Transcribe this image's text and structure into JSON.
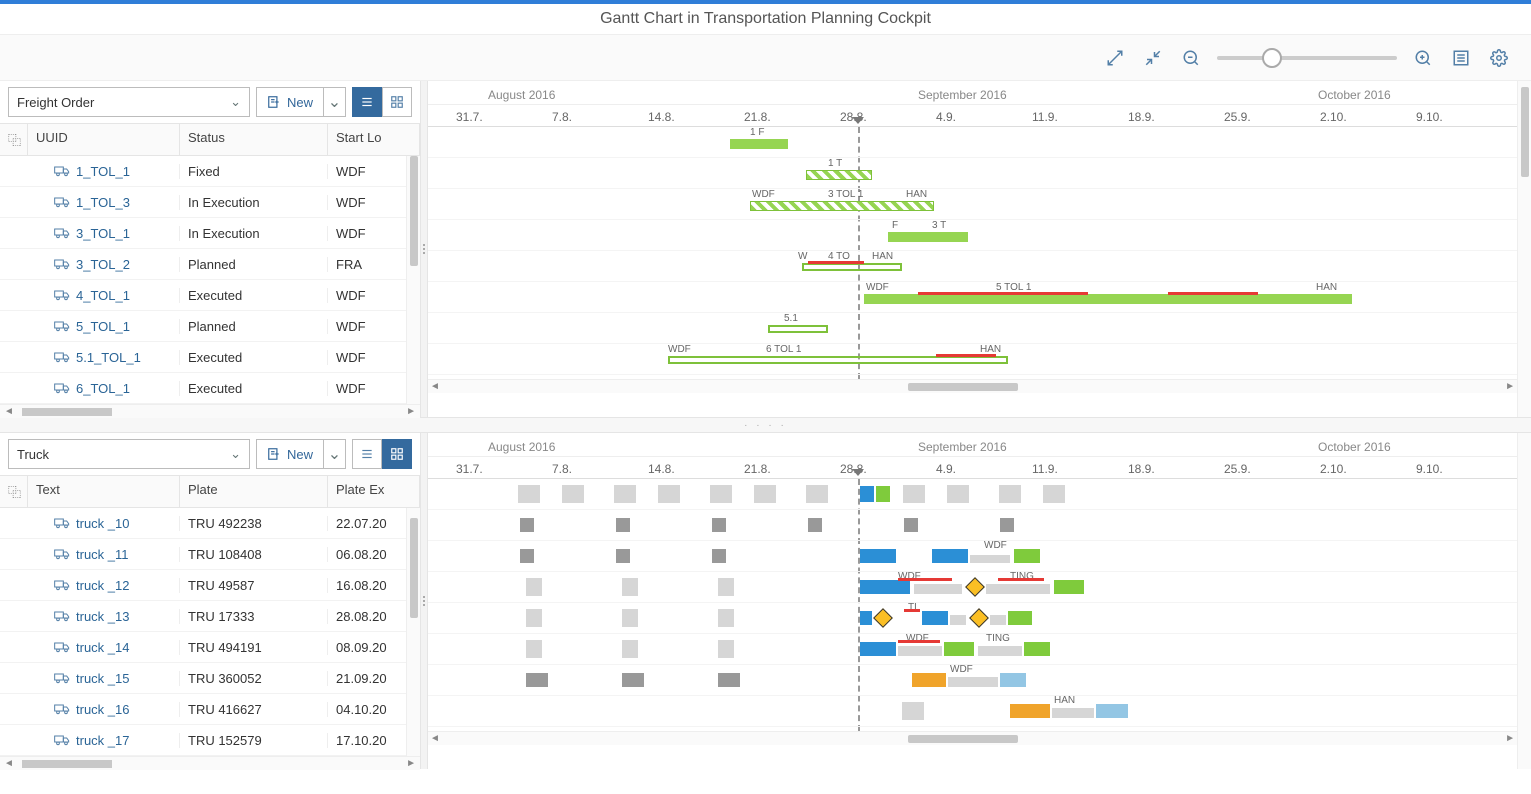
{
  "page": {
    "title": "Gantt Chart in Transportation Planning Cockpit"
  },
  "timeline": {
    "months": [
      "August 2016",
      "September 2016",
      "October 2016"
    ],
    "ticks": [
      "31.7.",
      "7.8.",
      "14.8.",
      "21.8.",
      "28.8.",
      "4.9.",
      "11.9.",
      "18.9.",
      "25.9.",
      "2.10.",
      "9.10."
    ]
  },
  "top": {
    "dropdown_value": "Freight Order",
    "new_button_label": "New",
    "columns": {
      "c1": "UUID",
      "c2": "Status",
      "c3": "Start Lo"
    },
    "rows": [
      {
        "uuid": "1_TOL_1",
        "status": "Fixed",
        "start": "WDF"
      },
      {
        "uuid": "1_TOL_3",
        "status": "In Execution",
        "start": "WDF"
      },
      {
        "uuid": "3_TOL_1",
        "status": "In Execution",
        "start": "WDF"
      },
      {
        "uuid": "3_TOL_2",
        "status": "Planned",
        "start": "FRA"
      },
      {
        "uuid": "4_TOL_1",
        "status": "Executed",
        "start": "WDF"
      },
      {
        "uuid": "5_TOL_1",
        "status": "Planned",
        "start": "WDF"
      },
      {
        "uuid": "5.1_TOL_1",
        "status": "Executed",
        "start": "WDF"
      },
      {
        "uuid": "6_TOL_1",
        "status": "Executed",
        "start": "WDF"
      }
    ],
    "bar_labels": {
      "r0": "1 F",
      "r1": "1 T",
      "r2a": "WDF",
      "r2b": "3 TOL 1",
      "r2c": "HAN",
      "r3a": "F",
      "r3b": "3 T",
      "r4a": "W",
      "r4b": "4 TO",
      "r4c": "HAN",
      "r5a": "WDF",
      "r5b": "5 TOL 1",
      "r5c": "HAN",
      "r6": "5.1",
      "r7a": "WDF",
      "r7b": "6 TOL 1",
      "r7c": "HAN"
    }
  },
  "bottom": {
    "dropdown_value": "Truck",
    "new_button_label": "New",
    "columns": {
      "c1": "Text",
      "c2": "Plate",
      "c3": "Plate Ex"
    },
    "rows": [
      {
        "text": "truck _10",
        "plate": "TRU 492238",
        "exp": "22.07.20"
      },
      {
        "text": "truck _11",
        "plate": "TRU 108408",
        "exp": "06.08.20"
      },
      {
        "text": "truck _12",
        "plate": "TRU 49587",
        "exp": "16.08.20"
      },
      {
        "text": "truck _13",
        "plate": "TRU 17333",
        "exp": "28.08.20"
      },
      {
        "text": "truck _14",
        "plate": "TRU 494191",
        "exp": "08.09.20"
      },
      {
        "text": "truck _15",
        "plate": "TRU 360052",
        "exp": "21.09.20"
      },
      {
        "text": "truck _16",
        "plate": "TRU 416627",
        "exp": "04.10.20"
      },
      {
        "text": "truck _17",
        "plate": "TRU 152579",
        "exp": "17.10.20"
      }
    ],
    "bar_labels": {
      "wdf": "WDF",
      "ting": "TING",
      "tl": "TL",
      "han": "HAN"
    }
  }
}
